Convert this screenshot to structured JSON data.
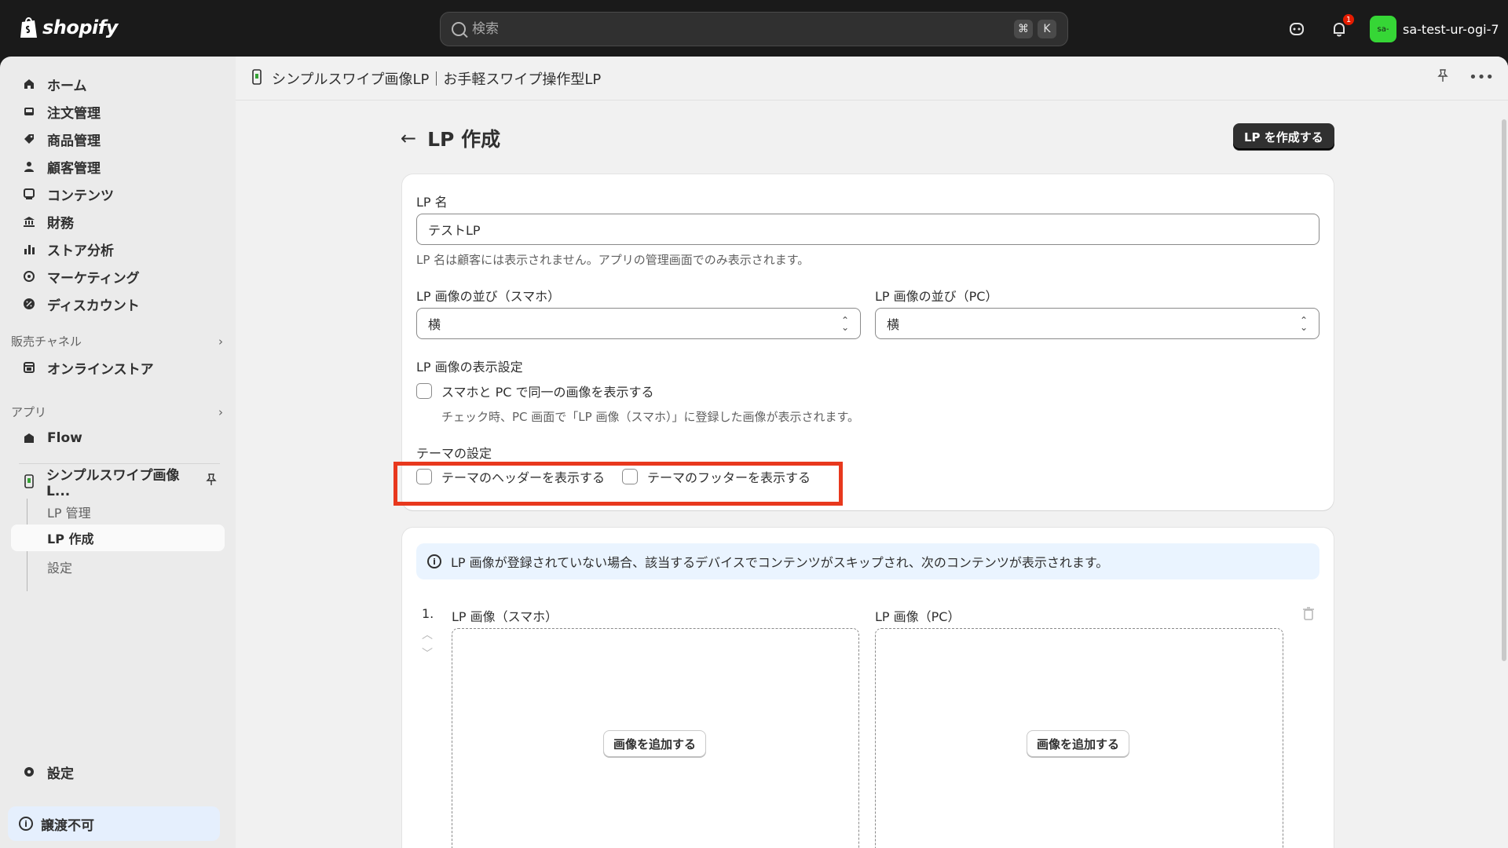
{
  "topbar": {
    "logo_text": "shopify",
    "search_placeholder": "検索",
    "shortcut_cmd": "⌘",
    "shortcut_key": "K",
    "notification_count": "1",
    "store_avatar": "sa-",
    "store_name": "sa-test-ur-ogi-7"
  },
  "sidebar": {
    "items": [
      {
        "label": "ホーム",
        "icon": "home-icon"
      },
      {
        "label": "注文管理",
        "icon": "inbox-icon"
      },
      {
        "label": "商品管理",
        "icon": "tag-icon"
      },
      {
        "label": "顧客管理",
        "icon": "person-icon"
      },
      {
        "label": "コンテンツ",
        "icon": "content-icon"
      },
      {
        "label": "財務",
        "icon": "bank-icon"
      },
      {
        "label": "ストア分析",
        "icon": "chart-icon"
      },
      {
        "label": "マーケティング",
        "icon": "target-icon"
      },
      {
        "label": "ディスカウント",
        "icon": "discount-icon"
      }
    ],
    "sales_channels_label": "販売チャネル",
    "online_store": "オンラインストア",
    "apps_label": "アプリ",
    "flow": "Flow",
    "app_name": "シンプルスワイプ画像L...",
    "sub_lp_manage": "LP 管理",
    "sub_lp_create": "LP 作成",
    "sub_settings": "設定",
    "settings": "設定",
    "notice": "譲渡不可"
  },
  "header": {
    "app_title": "シンプルスワイプ画像LP｜お手軽スワイプ操作型LP"
  },
  "page": {
    "title": "LP 作成",
    "primary_action": "LP を作成する"
  },
  "form": {
    "lp_name_label": "LP 名",
    "lp_name_value": "テストLP",
    "lp_name_help": "LP 名は顧客には表示されません。アプリの管理画面でのみ表示されます。",
    "order_sp_label": "LP 画像の並び（スマホ）",
    "order_sp_value": "横",
    "order_pc_label": "LP 画像の並び（PC）",
    "order_pc_value": "横",
    "display_label": "LP 画像の表示設定",
    "same_image_label": "スマホと PC で同一の画像を表示する",
    "same_image_help": "チェック時、PC 画面で「LP 画像（スマホ）」に登録した画像が表示されます。",
    "theme_label": "テーマの設定",
    "theme_header": "テーマのヘッダーを表示する",
    "theme_footer": "テーマのフッターを表示する"
  },
  "images": {
    "banner": "LP 画像が登録されていない場合、該当するデバイスでコンテンツがスキップされ、次のコンテンツが表示されます。",
    "row_number": "1.",
    "sp_label": "LP 画像（スマホ）",
    "pc_label": "LP 画像（PC）",
    "add_image": "画像を追加する"
  }
}
